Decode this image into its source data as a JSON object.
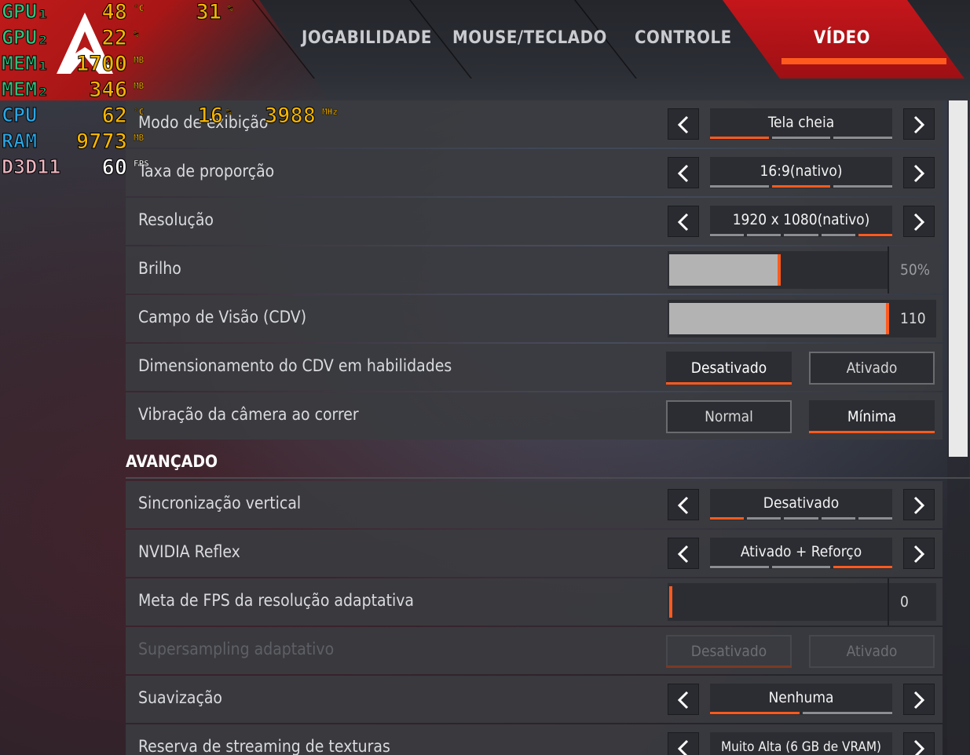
{
  "overlay": {
    "rows": [
      {
        "name": "GPU₁",
        "color": "#2ec27e",
        "value": "48",
        "unit": "°C",
        "value2": "31",
        "unit2": "%"
      },
      {
        "name": "GPU₂",
        "color": "#2ec27e",
        "value": "22",
        "unit": "%"
      },
      {
        "name": "MEM₁",
        "color": "#2ec27e",
        "value": "1700",
        "unit": "MB"
      },
      {
        "name": "MEM₂",
        "color": "#2ec27e",
        "value": "346",
        "unit": "MB"
      },
      {
        "name": "CPU",
        "color": "#2aa7e6",
        "value": "62",
        "unit": "°C",
        "value2": "16",
        "unit2": "%",
        "value3": "3988",
        "unit3": "MHz"
      },
      {
        "name": "RAM",
        "color": "#2aa7e6",
        "value": "9773",
        "unit": "MB"
      },
      {
        "name": "D3D11",
        "color": "#f0b8c2",
        "value": "60",
        "unit": "FPS"
      }
    ]
  },
  "tabs": [
    {
      "label": "JOGABILIDADE"
    },
    {
      "label": "MOUSE/TECLADO"
    },
    {
      "label": "CONTROLE"
    },
    {
      "label": "VÍDEO",
      "active": true
    }
  ],
  "settings": {
    "display_mode": {
      "label": "Modo de exibição",
      "value": "Tela cheia",
      "segments": 3,
      "selected": 0
    },
    "aspect_ratio": {
      "label": "Taxa de proporção",
      "value": "16:9(nativo)",
      "segments": 3,
      "selected": 1
    },
    "resolution": {
      "label": "Resolução",
      "value": "1920 x 1080(nativo)",
      "segments": 5,
      "selected": 4
    },
    "brightness": {
      "label": "Brilho",
      "value": "50%",
      "level": 0.5
    },
    "fov": {
      "label": "Campo de Visão (CDV)",
      "value": "110",
      "level": 1.0
    },
    "fov_scaling": {
      "label": "Dimensionamento do CDV em habilidades",
      "options": [
        "Desativado",
        "Ativado"
      ],
      "selected": 0
    },
    "camera_shake": {
      "label": "Vibração da câmera ao correr",
      "options": [
        "Normal",
        "Mínima"
      ],
      "selected": 1
    }
  },
  "advanced": {
    "title": "AVANÇADO",
    "vsync": {
      "label": "Sincronização vertical",
      "value": "Desativado",
      "segments": 5,
      "selected": 0
    },
    "reflex": {
      "label": "NVIDIA Reflex",
      "value": "Ativado + Reforço",
      "segments": 3,
      "selected": 2
    },
    "adaptive_fps": {
      "label": "Meta de FPS da resolução adaptativa",
      "value": "0",
      "level": 0.0
    },
    "supersampling": {
      "label": "Supersampling adaptativo",
      "options": [
        "Desativado",
        "Ativado"
      ],
      "selected": 0,
      "disabled": true
    },
    "antialiasing": {
      "label": "Suavização",
      "value": "Nenhuma",
      "segments": 2,
      "selected": 0
    },
    "texture_budget": {
      "label": "Reserva de streaming de texturas",
      "value": "Muito Alta (6 GB de VRAM)"
    }
  },
  "colors": {
    "accent": "#ff5a1e",
    "active_tab": "#c4161b",
    "brand": "#c01a1a"
  }
}
